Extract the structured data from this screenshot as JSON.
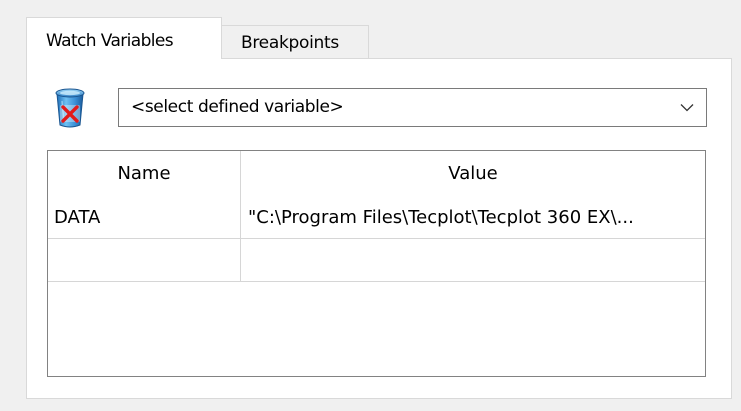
{
  "tabs": [
    {
      "label": "Watch Variables",
      "active": true
    },
    {
      "label": "Breakpoints",
      "active": false
    }
  ],
  "toolbar": {
    "delete_icon": "recycle-bin-delete-icon",
    "variable_select": {
      "selected": "<select defined variable>",
      "arrow_icon": "chevron-down-icon"
    }
  },
  "table": {
    "columns": [
      "Name",
      "Value"
    ],
    "rows": [
      {
        "name": "DATA",
        "value": "\"C:\\Program Files\\Tecplot\\Tecplot 360 EX\\..."
      },
      {
        "name": "",
        "value": ""
      }
    ]
  },
  "colors": {
    "window_bg": "#f0f0f0",
    "panel_bg": "#ffffff",
    "border": "#d9d9d9",
    "grid_border": "#828282",
    "grid_lines": "#d6d6d6",
    "trash_blue": "#3a8fd6",
    "delete_red": "#e21b1b"
  }
}
